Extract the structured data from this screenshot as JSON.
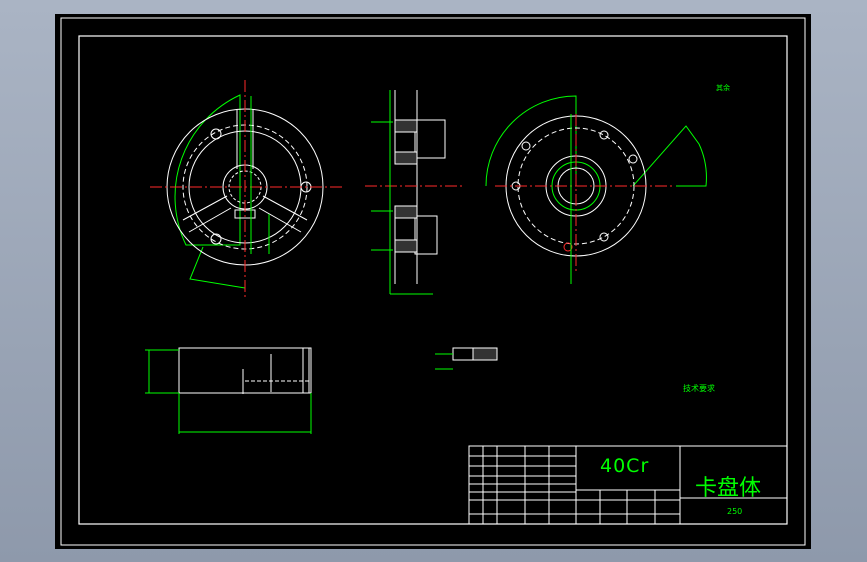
{
  "title_block": {
    "material": "40Cr",
    "part_name": "卡盘体",
    "scale": "250"
  },
  "technical_requirements": {
    "heading": "技术要求"
  },
  "corner_note": "其余"
}
